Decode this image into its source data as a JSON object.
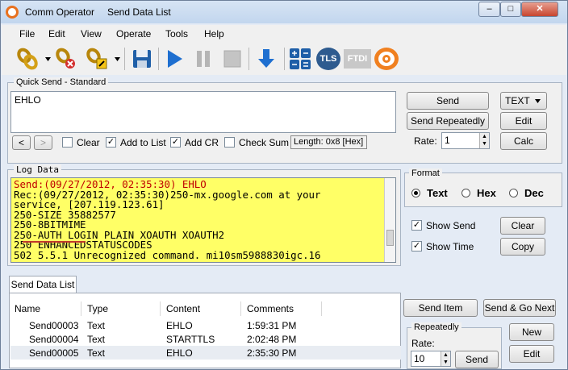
{
  "window": {
    "app_title": "Comm Operator",
    "doc_title": "Send Data List",
    "min": "–",
    "max": "□",
    "close": "✕"
  },
  "menu": [
    "File",
    "Edit",
    "View",
    "Operate",
    "Tools",
    "Help"
  ],
  "toolbar": {
    "tls_label": "TLS",
    "ftdi_label": "FTDI"
  },
  "quick_send": {
    "legend": "Quick Send - Standard",
    "text": "EHLO",
    "send": "Send",
    "send_repeatedly": "Send Repeatedly",
    "format_value": "TEXT",
    "edit": "Edit",
    "rate_label": "Rate:",
    "rate_value": "1",
    "calc": "Calc",
    "nav_prev": "<",
    "nav_next": ">",
    "clear": "Clear",
    "add_to_list": "Add to List",
    "add_cr": "Add CR",
    "check_sum": "Check Sum",
    "length": "Length: 0x8 [Hex]",
    "checks": {
      "clear": false,
      "add_to_list": true,
      "add_cr": true,
      "check_sum": false
    }
  },
  "log": {
    "legend": "Log Data",
    "lines": [
      "Send:(09/27/2012, 02:35:30) EHLO",
      "Rec:(09/27/2012, 02:35:30)250-mx.google.com at your",
      "service, [207.119.123.61]",
      "250-SIZE 35882577",
      "250-8BITMIME",
      "250-AUTH LOGIN PLAIN XOAUTH XOAUTH2",
      "250 ENHANCEDSTATUSCODES",
      "502 5.5.1 Unrecognized command. mi10sm5988830igc.16"
    ],
    "colors": {
      "send": "#c00000",
      "rec": "#000000",
      "background": "#ffff66",
      "underline": "#c0392b"
    }
  },
  "format": {
    "legend": "Format",
    "options": [
      "Text",
      "Hex",
      "Dec"
    ],
    "selected": "Text",
    "show_send": "Show Send",
    "show_time": "Show Time",
    "clear": "Clear",
    "copy": "Copy",
    "show_send_checked": true,
    "show_time_checked": true
  },
  "send_list": {
    "tab": "Send Data List",
    "columns": [
      "Name",
      "Type",
      "Content",
      "Comments"
    ],
    "rows": [
      {
        "name": "Send00003",
        "type": "Text",
        "content": "EHLO",
        "comments": "1:59:31 PM"
      },
      {
        "name": "Send00004",
        "type": "Text",
        "content": "STARTTLS",
        "comments": "2:02:48 PM"
      },
      {
        "name": "Send00005",
        "type": "Text",
        "content": "EHLO",
        "comments": "2:35:30 PM"
      }
    ],
    "send_item": "Send Item",
    "send_go_next": "Send & Go Next",
    "repeatedly_legend": "Repeatedly",
    "rate_label": "Rate:",
    "rate_value": "10",
    "send": "Send",
    "new": "New",
    "edit": "Edit"
  }
}
